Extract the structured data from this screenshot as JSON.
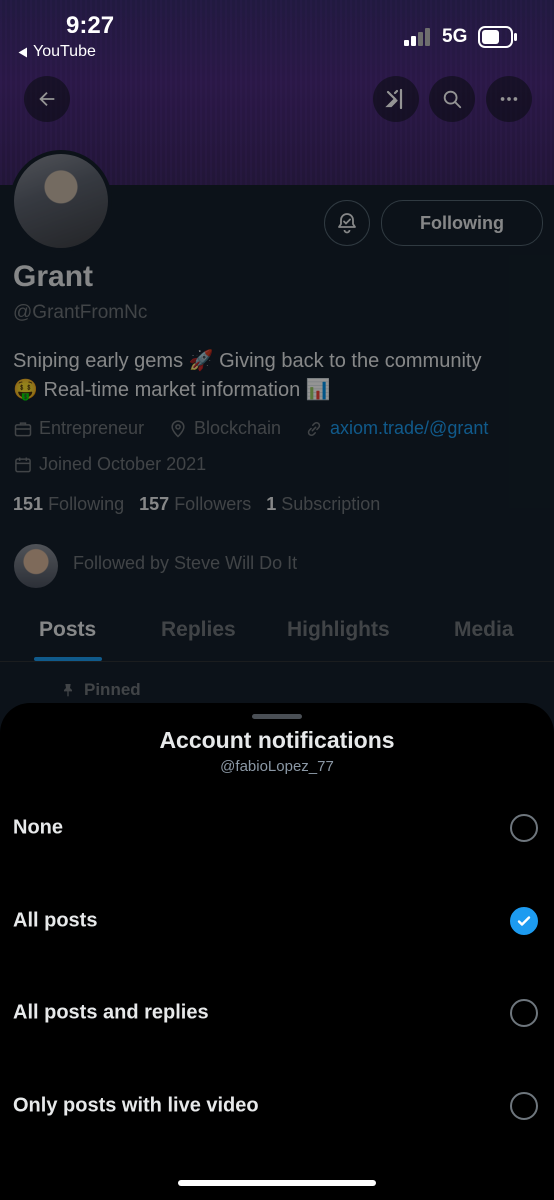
{
  "status_bar": {
    "time": "9:27",
    "back_app": "YouTube",
    "network": "5G"
  },
  "toolbar": {
    "back_icon": "arrow-left-icon",
    "grok_icon": "grok-icon",
    "search_icon": "search-icon",
    "more_icon": "more-icon"
  },
  "profile": {
    "name": "Grant",
    "handle": "@GrantFromNc",
    "bio_line1": "Sniping early gems 🚀 Giving back to the community",
    "bio_line2": "🤑 Real-time market information 📊",
    "occupation": "Entrepreneur",
    "location": "Blockchain",
    "website": "axiom.trade/@grant",
    "joined": "Joined October 2021",
    "following_count": "151",
    "following_label": "Following",
    "followers_count": "157",
    "followers_label": "Followers",
    "subscription_count": "1",
    "subscription_label": "Subscription",
    "followed_by": "Followed by Steve Will Do It",
    "following_button": "Following"
  },
  "tabs": [
    {
      "label": "Posts",
      "active": true
    },
    {
      "label": "Replies",
      "active": false
    },
    {
      "label": "Highlights",
      "active": false
    },
    {
      "label": "Media",
      "active": false
    }
  ],
  "pinned_label": "Pinned",
  "sheet": {
    "title": "Account notifications",
    "subtitle": "@fabioLopez_77",
    "options": [
      {
        "label": "None",
        "selected": false
      },
      {
        "label": "All posts",
        "selected": true
      },
      {
        "label": "All posts and replies",
        "selected": false
      },
      {
        "label": "Only posts with live video",
        "selected": false
      }
    ]
  },
  "colors": {
    "accent": "#1d9bf0",
    "link": "#1d9bf0",
    "background": "#15202b",
    "sheet_background": "#000000"
  }
}
